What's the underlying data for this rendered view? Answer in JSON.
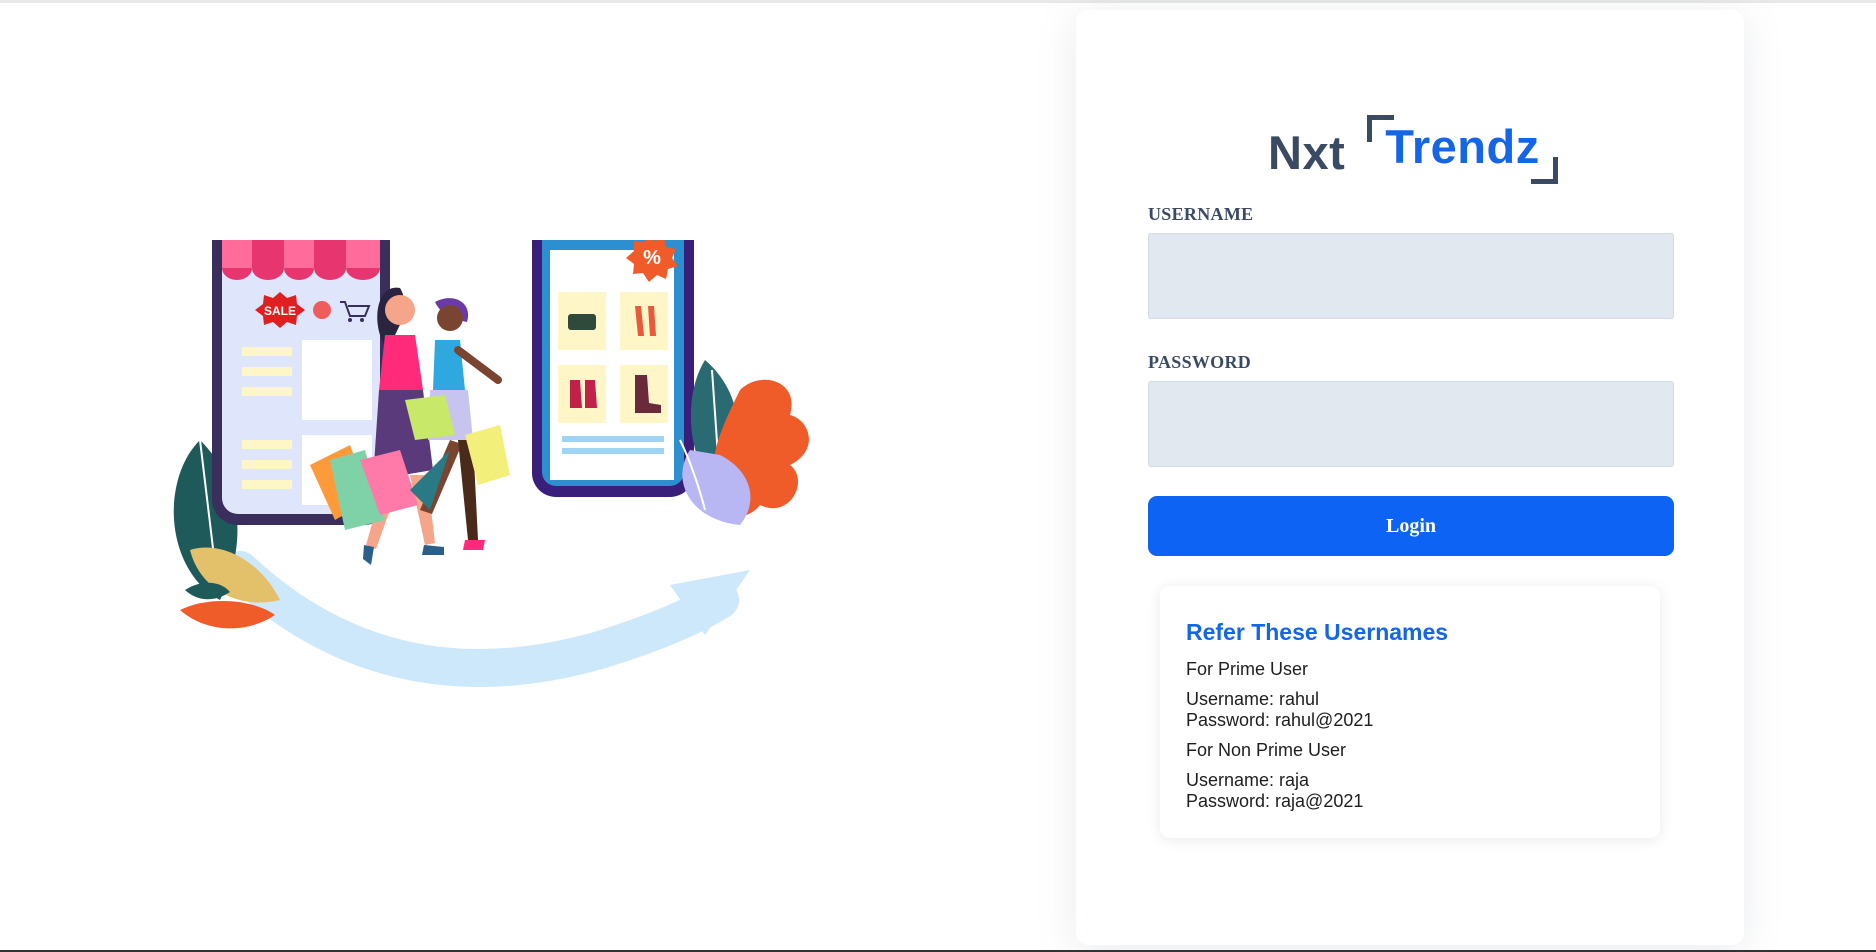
{
  "brand": {
    "part1": "Nxt",
    "part2": "Trendz"
  },
  "form": {
    "username_label": "USERNAME",
    "username_value": "",
    "password_label": "PASSWORD",
    "password_value": "",
    "login_label": "Login"
  },
  "hints": {
    "title": "Refer These Usernames",
    "prime_heading": "For Prime User",
    "prime_username": "Username: rahul",
    "prime_password": "Password: rahul@2021",
    "nonprime_heading": "For Non Prime User",
    "nonprime_username": "Username: raja",
    "nonprime_password": "Password: raja@2021"
  },
  "illustration": {
    "sale_tag": "SALE",
    "discount_symbol": "%"
  },
  "colors": {
    "brand_blue": "#1565e8",
    "button_blue": "#0d63f3",
    "label_slate": "#3b4a63",
    "input_bg": "#e2e8f0"
  }
}
